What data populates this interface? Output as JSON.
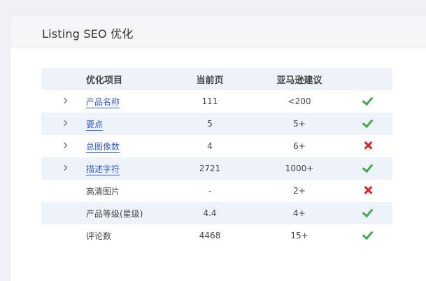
{
  "panel": {
    "title": "Listing SEO 优化"
  },
  "table": {
    "headers": {
      "item": "优化项目",
      "current": "当前页",
      "suggest": "亚马逊建议"
    },
    "rows": [
      {
        "label": "产品名称",
        "current": "111",
        "suggest": "<200",
        "expandable": true,
        "link": true,
        "status": "pass"
      },
      {
        "label": "要点",
        "current": "5",
        "suggest": "5+",
        "expandable": true,
        "link": true,
        "status": "pass"
      },
      {
        "label": "总图像数",
        "current": "4",
        "suggest": "6+",
        "expandable": true,
        "link": true,
        "status": "fail"
      },
      {
        "label": "描述字符",
        "current": "2721",
        "suggest": "1000+",
        "expandable": true,
        "link": true,
        "status": "pass"
      },
      {
        "label": "高清图片",
        "current": "-",
        "suggest": "2+",
        "expandable": false,
        "link": false,
        "status": "fail"
      },
      {
        "label": "产品等级(星级)",
        "current": "4.4",
        "suggest": "4+",
        "expandable": false,
        "link": false,
        "status": "pass"
      },
      {
        "label": "评论数",
        "current": "4468",
        "suggest": "15+",
        "expandable": false,
        "link": false,
        "status": "pass"
      }
    ]
  },
  "colors": {
    "pass": "#46a84e",
    "fail": "#e02020",
    "link": "#2f5fc4",
    "stripe": "#eef3fa"
  }
}
